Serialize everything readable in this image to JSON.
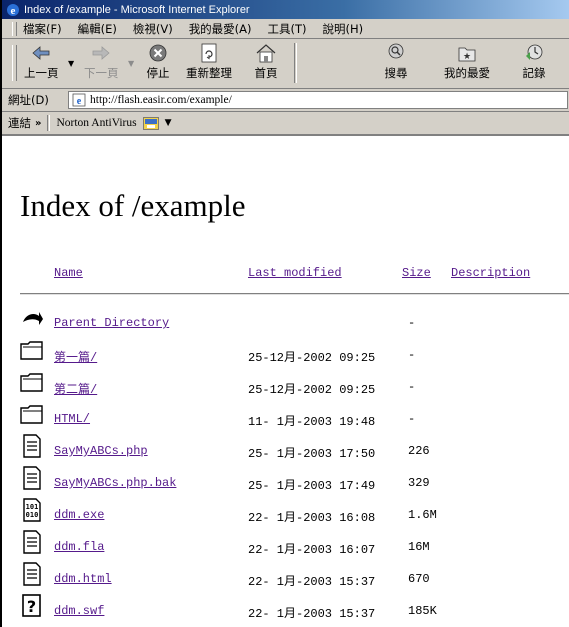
{
  "window": {
    "title": "Index of /example - Microsoft Internet Explorer"
  },
  "menu": [
    "檔案(F)",
    "編輯(E)",
    "檢視(V)",
    "我的最愛(A)",
    "工具(T)",
    "說明(H)"
  ],
  "toolbar": {
    "back": "上一頁",
    "forward": "下一頁",
    "stop": "停止",
    "refresh": "重新整理",
    "home": "首頁",
    "search": "搜尋",
    "favorites": "我的最愛",
    "history": "記錄"
  },
  "address": {
    "label": "網址(D)",
    "url": "http://flash.easir.com/example/"
  },
  "links": {
    "label": "連結",
    "chevron": "»",
    "item": "Norton AntiVirus"
  },
  "page": {
    "heading": "Index of /example",
    "columns": {
      "name": "Name",
      "modified": "Last modified",
      "size": "Size",
      "description": "Description"
    },
    "rows": [
      {
        "icon": "back-arrow",
        "name": "Parent Directory",
        "date": "",
        "size": "-"
      },
      {
        "icon": "folder",
        "name": "第一篇/",
        "date": "25-12月-2002 09:25",
        "size": "-"
      },
      {
        "icon": "folder",
        "name": "第二篇/",
        "date": "25-12月-2002 09:25",
        "size": "-"
      },
      {
        "icon": "folder",
        "name": "HTML/",
        "date": "11- 1月-2003 19:48",
        "size": "-"
      },
      {
        "icon": "text-file",
        "name": "SayMyABCs.php",
        "date": "25- 1月-2003 17:50",
        "size": "226"
      },
      {
        "icon": "text-file",
        "name": "SayMyABCs.php.bak",
        "date": "25- 1月-2003 17:49",
        "size": "329"
      },
      {
        "icon": "binary-file",
        "name": "ddm.exe",
        "date": "22- 1月-2003 16:08",
        "size": "1.6M"
      },
      {
        "icon": "text-file",
        "name": "ddm.fla",
        "date": "22- 1月-2003 16:07",
        "size": " 16M"
      },
      {
        "icon": "text-file",
        "name": "ddm.html",
        "date": "22- 1月-2003 15:37",
        "size": "670"
      },
      {
        "icon": "unknown-file",
        "name": "ddm.swf",
        "date": "22- 1月-2003 15:37",
        "size": "185K"
      }
    ]
  },
  "colors": {
    "link": "#551a8b",
    "chrome": "#d4d0c8",
    "titlebar": "#0a246a"
  }
}
